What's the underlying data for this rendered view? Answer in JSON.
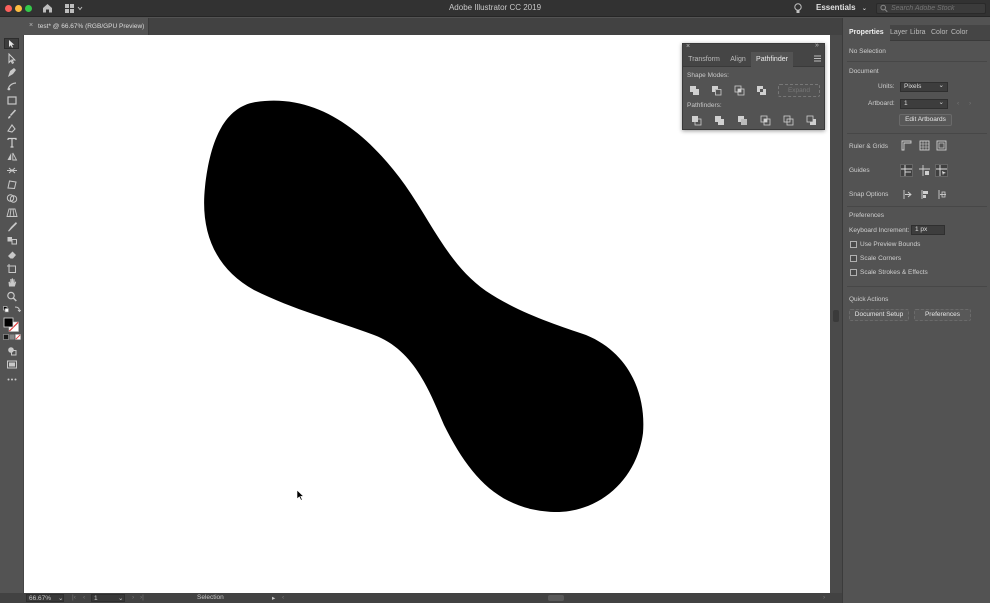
{
  "app": {
    "title": "Adobe Illustrator CC 2019"
  },
  "workspace": {
    "label": "Essentials",
    "search_placeholder": "Search Adobe Stock"
  },
  "document": {
    "tab_label": "test* @ 66.67% (RGB/GPU Preview)",
    "close_glyph": "×"
  },
  "status": {
    "zoom": "66.67%",
    "artboard_number": "1",
    "tool_name": "Selection"
  },
  "pathfinder": {
    "tabs": [
      "Transform",
      "Align",
      "Pathfinder"
    ],
    "active_tab": "Pathfinder",
    "shape_modes_label": "Shape Modes:",
    "pathfinders_label": "Pathfinders:",
    "expand_label": "Expand"
  },
  "properties": {
    "tabs": [
      "Properties",
      "Layer",
      "Libra",
      "Color",
      "Color"
    ],
    "selection_label": "No Selection",
    "document_label": "Document",
    "units_label": "Units:",
    "units_value": "Pixels",
    "artboard_label": "Artboard:",
    "artboard_value": "1",
    "edit_artboards": "Edit Artboards",
    "ruler_grids": "Ruler & Grids",
    "guides": "Guides",
    "snap_options": "Snap Options",
    "preferences_title": "Preferences",
    "keyboard_increment_label": "Keyboard Increment:",
    "keyboard_increment_value": "1 px",
    "use_preview_bounds": "Use Preview Bounds",
    "scale_corners": "Scale Corners",
    "scale_strokes": "Scale Strokes & Effects",
    "quick_actions": "Quick Actions",
    "document_setup": "Document Setup",
    "preferences_button": "Preferences"
  },
  "colors": {
    "fill": "#000000",
    "canvas": "#ffffff",
    "chrome": "#535353"
  }
}
